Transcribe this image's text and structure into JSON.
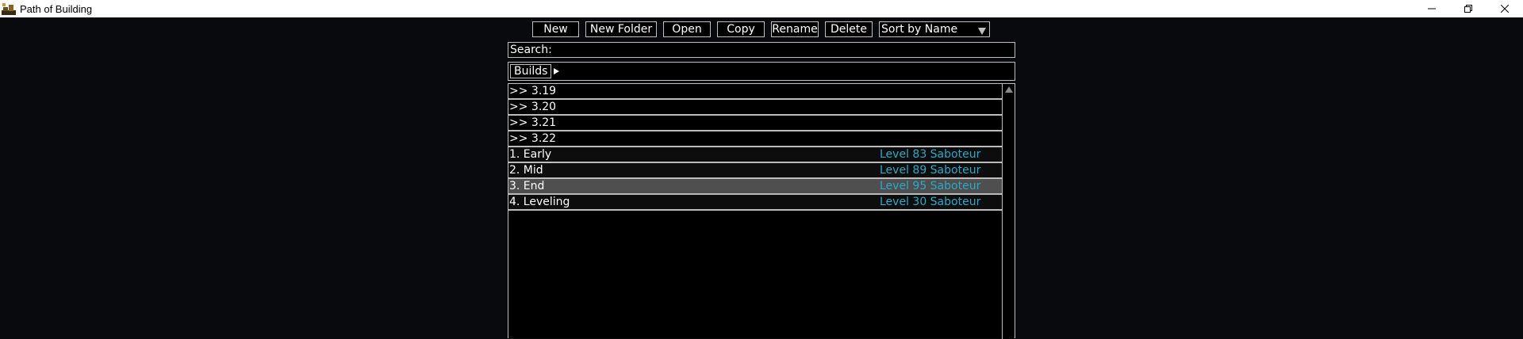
{
  "window": {
    "title": "Path of Building",
    "controls": [
      "minimize",
      "restore",
      "close"
    ]
  },
  "toolbar": {
    "new_label": "New",
    "new_folder_label": "New Folder",
    "open_label": "Open",
    "copy_label": "Copy",
    "rename_label": "Rename",
    "delete_label": "Delete",
    "sort_label": "Sort by Name"
  },
  "search": {
    "label": "Search:",
    "value": ""
  },
  "breadcrumb": {
    "items": [
      "Builds"
    ]
  },
  "colors": {
    "info_text": "#2aa9c8",
    "selected_row": "#4f4f4f",
    "background": "#080a0d"
  },
  "builds": {
    "folders": [
      {
        "name": ">> 3.19"
      },
      {
        "name": ">> 3.20"
      },
      {
        "name": ">> 3.21"
      },
      {
        "name": ">> 3.22"
      }
    ],
    "files": [
      {
        "name": "1. Early",
        "info": "Level 83 Saboteur",
        "selected": false
      },
      {
        "name": "2. Mid",
        "info": "Level 89 Saboteur",
        "selected": false
      },
      {
        "name": "3. End",
        "info": "Level 95 Saboteur",
        "selected": true
      },
      {
        "name": "4. Leveling",
        "info": "Level 30 Saboteur",
        "selected": false
      }
    ]
  }
}
